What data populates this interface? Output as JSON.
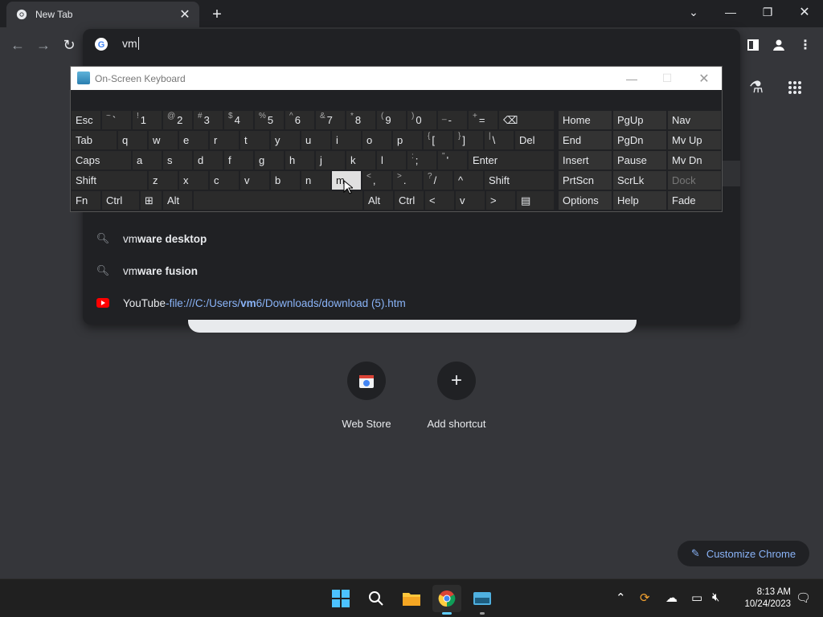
{
  "browser": {
    "tab_title": "New Tab",
    "omnibox_value": "vm",
    "suggestions": [
      {
        "icon": "search-icon",
        "prefix": "vm",
        "bold": "ware desktop"
      },
      {
        "icon": "search-icon",
        "prefix": "vm",
        "bold": "ware fusion"
      },
      {
        "icon": "youtube-icon",
        "title": "YouTube",
        "sep": " - ",
        "url_pre": "file:///C:/Users/",
        "url_bold": "vm",
        "url_post": "6/Downloads/download (5).htm"
      }
    ],
    "shortcuts": [
      {
        "label": "Web Store"
      },
      {
        "label": "Add shortcut"
      }
    ],
    "customize_label": "Customize Chrome"
  },
  "osk": {
    "title": "On-Screen Keyboard",
    "rows": [
      [
        {
          "k": "Esc"
        },
        {
          "s": "~",
          "k": "`"
        },
        {
          "s": "!",
          "k": "1"
        },
        {
          "s": "@",
          "k": "2"
        },
        {
          "s": "#",
          "k": "3"
        },
        {
          "s": "$",
          "k": "4"
        },
        {
          "s": "%",
          "k": "5"
        },
        {
          "s": "^",
          "k": "6"
        },
        {
          "s": "&",
          "k": "7"
        },
        {
          "s": "*",
          "k": "8"
        },
        {
          "s": "(",
          "k": "9"
        },
        {
          "s": ")",
          "k": "0"
        },
        {
          "s": "_",
          "k": "-"
        },
        {
          "s": "+",
          "k": "="
        },
        {
          "k": "⌫"
        },
        {
          "k": "Home"
        },
        {
          "k": "PgUp"
        },
        {
          "k": "Nav"
        }
      ],
      [
        {
          "k": "Tab"
        },
        {
          "k": "q"
        },
        {
          "k": "w"
        },
        {
          "k": "e"
        },
        {
          "k": "r"
        },
        {
          "k": "t"
        },
        {
          "k": "y"
        },
        {
          "k": "u"
        },
        {
          "k": "i"
        },
        {
          "k": "o"
        },
        {
          "k": "p"
        },
        {
          "s": "{",
          "k": "["
        },
        {
          "s": "}",
          "k": "]"
        },
        {
          "s": "|",
          "k": "\\"
        },
        {
          "k": "Del"
        },
        {
          "k": "End"
        },
        {
          "k": "PgDn"
        },
        {
          "k": "Mv Up"
        }
      ],
      [
        {
          "k": "Caps"
        },
        {
          "k": "a"
        },
        {
          "k": "s"
        },
        {
          "k": "d"
        },
        {
          "k": "f"
        },
        {
          "k": "g"
        },
        {
          "k": "h"
        },
        {
          "k": "j"
        },
        {
          "k": "k"
        },
        {
          "k": "l"
        },
        {
          "s": ":",
          "k": ";"
        },
        {
          "s": "\"",
          "k": "'"
        },
        {
          "k": "Enter"
        },
        {
          "k": "Insert"
        },
        {
          "k": "Pause"
        },
        {
          "k": "Mv Dn"
        }
      ],
      [
        {
          "k": "Shift"
        },
        {
          "k": "z"
        },
        {
          "k": "x"
        },
        {
          "k": "c"
        },
        {
          "k": "v"
        },
        {
          "k": "b"
        },
        {
          "k": "n"
        },
        {
          "k": "m"
        },
        {
          "s": "<",
          "k": ","
        },
        {
          "s": ">",
          "k": "."
        },
        {
          "s": "?",
          "k": "/"
        },
        {
          "k": "^"
        },
        {
          "k": "Shift"
        },
        {
          "k": "PrtScn"
        },
        {
          "k": "ScrLk"
        },
        {
          "k": "Dock"
        }
      ],
      [
        {
          "k": "Fn"
        },
        {
          "k": "Ctrl"
        },
        {
          "k": "⊞"
        },
        {
          "k": "Alt"
        },
        {
          "k": ""
        },
        {
          "k": "Alt"
        },
        {
          "k": "Ctrl"
        },
        {
          "k": "<"
        },
        {
          "k": "v"
        },
        {
          "k": ">"
        },
        {
          "k": "▤"
        },
        {
          "k": "Options"
        },
        {
          "k": "Help"
        },
        {
          "k": "Fade"
        }
      ]
    ]
  },
  "taskbar": {
    "time": "8:13 AM",
    "date": "10/24/2023"
  }
}
